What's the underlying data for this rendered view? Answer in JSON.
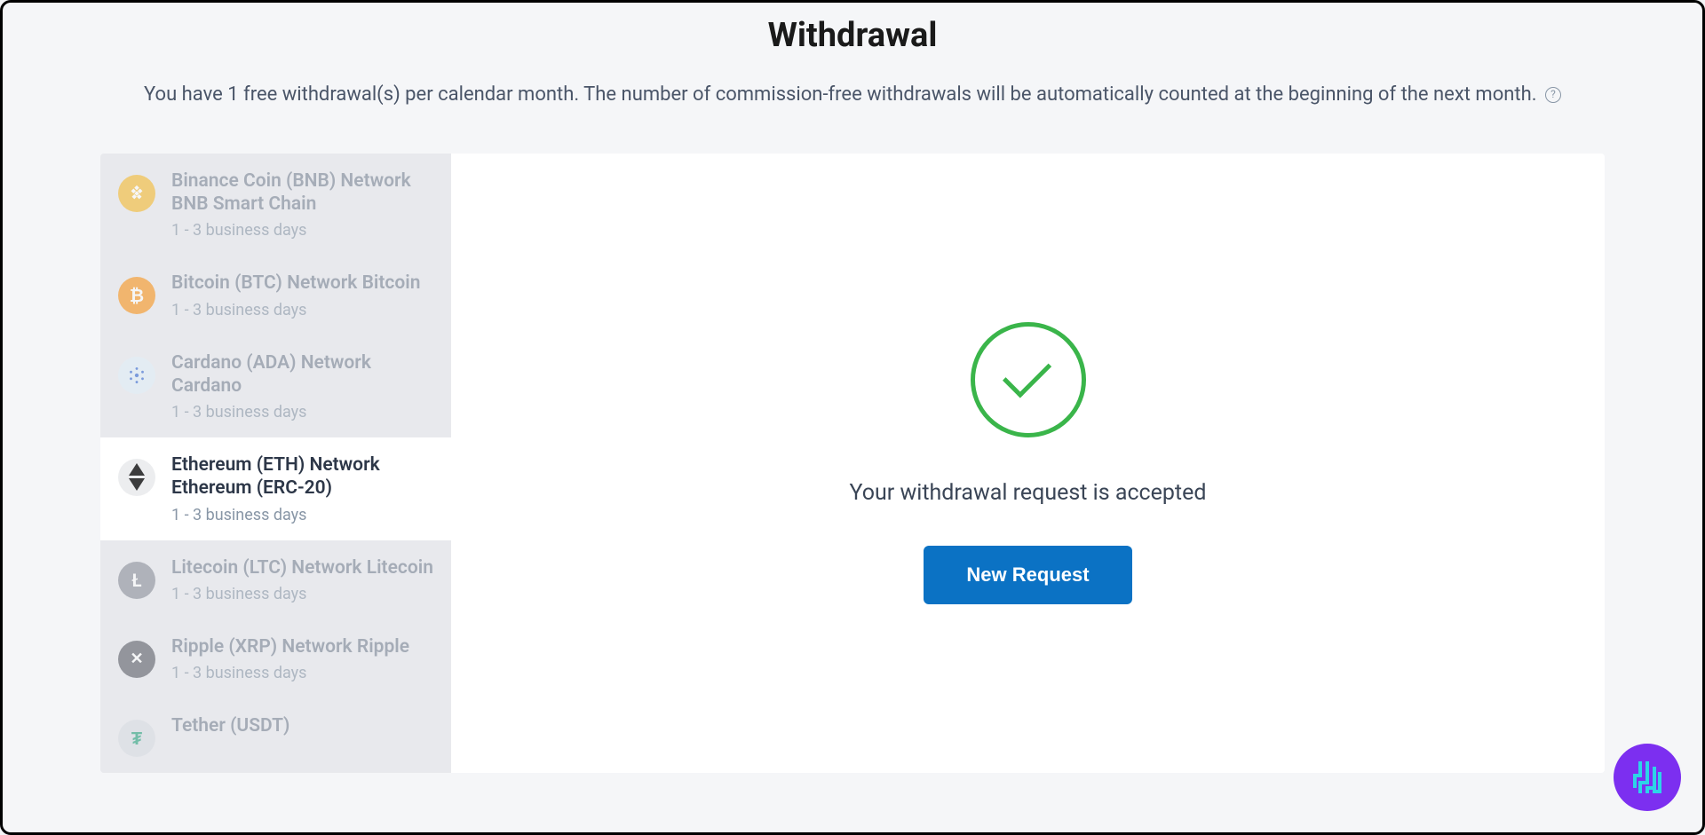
{
  "header": {
    "title": "Withdrawal",
    "subtitle_part1": "You have 1 free withdrawal(s) per calendar month. The number of commission-free withdrawals will be automatically counted at the beginning of the next month.",
    "help_glyph": "?"
  },
  "sidebar": {
    "items": [
      {
        "name": "Binance Coin (BNB) Network BNB Smart Chain",
        "duration": "1 - 3 business days",
        "icon": "bnb",
        "selected": false
      },
      {
        "name": "Bitcoin (BTC) Network Bitcoin",
        "duration": "1 - 3 business days",
        "icon": "btc",
        "selected": false
      },
      {
        "name": "Cardano (ADA) Network Cardano",
        "duration": "1 - 3 business days",
        "icon": "ada",
        "selected": false
      },
      {
        "name": "Ethereum (ETH) Network Ethereum (ERC-20)",
        "duration": "1 - 3 business days",
        "icon": "eth",
        "selected": true
      },
      {
        "name": "Litecoin (LTC) Network Litecoin",
        "duration": "1 - 3 business days",
        "icon": "ltc",
        "selected": false
      },
      {
        "name": "Ripple (XRP) Network Ripple",
        "duration": "1 - 3 business days",
        "icon": "xrp",
        "selected": false
      },
      {
        "name": "Tether (USDT)",
        "duration": "",
        "icon": "usdt",
        "selected": false
      }
    ]
  },
  "main": {
    "success_message": "Your withdrawal request is accepted",
    "new_request_label": "New Request"
  },
  "colors": {
    "accent_green": "#3ab54a",
    "primary_blue": "#0b72c4",
    "badge_purple": "#7c2ff0",
    "badge_cyan": "#2dd4e8"
  }
}
